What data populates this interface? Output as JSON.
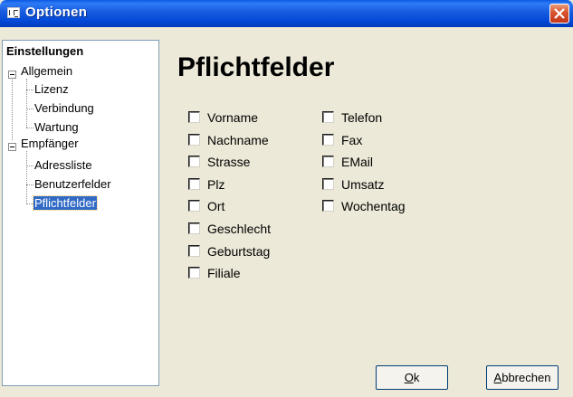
{
  "window": {
    "title": "Optionen"
  },
  "tree": {
    "root": "Einstellungen",
    "groups": [
      {
        "label": "Allgemein",
        "children": [
          "Lizenz",
          "Verbindung",
          "Wartung"
        ]
      },
      {
        "label": "Empfänger",
        "children": [
          "Adressliste",
          "Benutzerfelder",
          "Pflichtfelder"
        ]
      }
    ],
    "selected": "Pflichtfelder"
  },
  "main": {
    "title": "Pflichtfelder",
    "fields_col1": [
      "Vorname",
      "Nachname",
      "Strasse",
      "Plz",
      "Ort",
      "Geschlecht",
      "Geburtstag",
      "Filiale"
    ],
    "fields_col2": [
      "Telefon",
      "Fax",
      "EMail",
      "Umsatz",
      "Wochentag"
    ]
  },
  "buttons": {
    "ok": {
      "hotkey": "O",
      "rest": "k"
    },
    "cancel": {
      "hotkey": "A",
      "rest": "bbrechen"
    }
  },
  "colors": {
    "selection": "#316ac5",
    "titlebar": "#0047d6",
    "background": "#ece9d8"
  }
}
